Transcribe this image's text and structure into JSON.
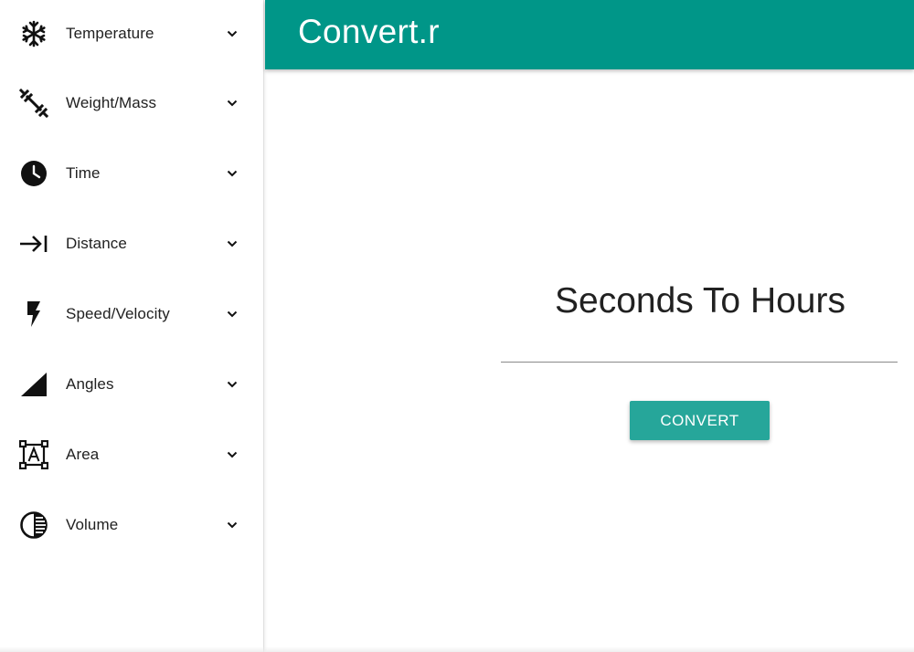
{
  "app": {
    "title": "Convert.r",
    "brand_color": "#009688",
    "button_color": "#26a69a"
  },
  "sidebar": {
    "items": [
      {
        "label": "Temperature",
        "icon": "snowflake-icon"
      },
      {
        "label": "Weight/Mass",
        "icon": "dumbbell-icon"
      },
      {
        "label": "Time",
        "icon": "clock-icon"
      },
      {
        "label": "Distance",
        "icon": "arrow-to-line-icon"
      },
      {
        "label": "Speed/Velocity",
        "icon": "lightning-icon"
      },
      {
        "label": "Angles",
        "icon": "triangle-angle-icon"
      },
      {
        "label": "Area",
        "icon": "area-text-box-icon"
      },
      {
        "label": "Volume",
        "icon": "half-circle-volume-icon"
      }
    ],
    "chevron_icon": "chevron-down-icon"
  },
  "main": {
    "title": "Seconds To Hours",
    "input_value": "",
    "input_placeholder": "",
    "convert_label": "CONVERT"
  }
}
